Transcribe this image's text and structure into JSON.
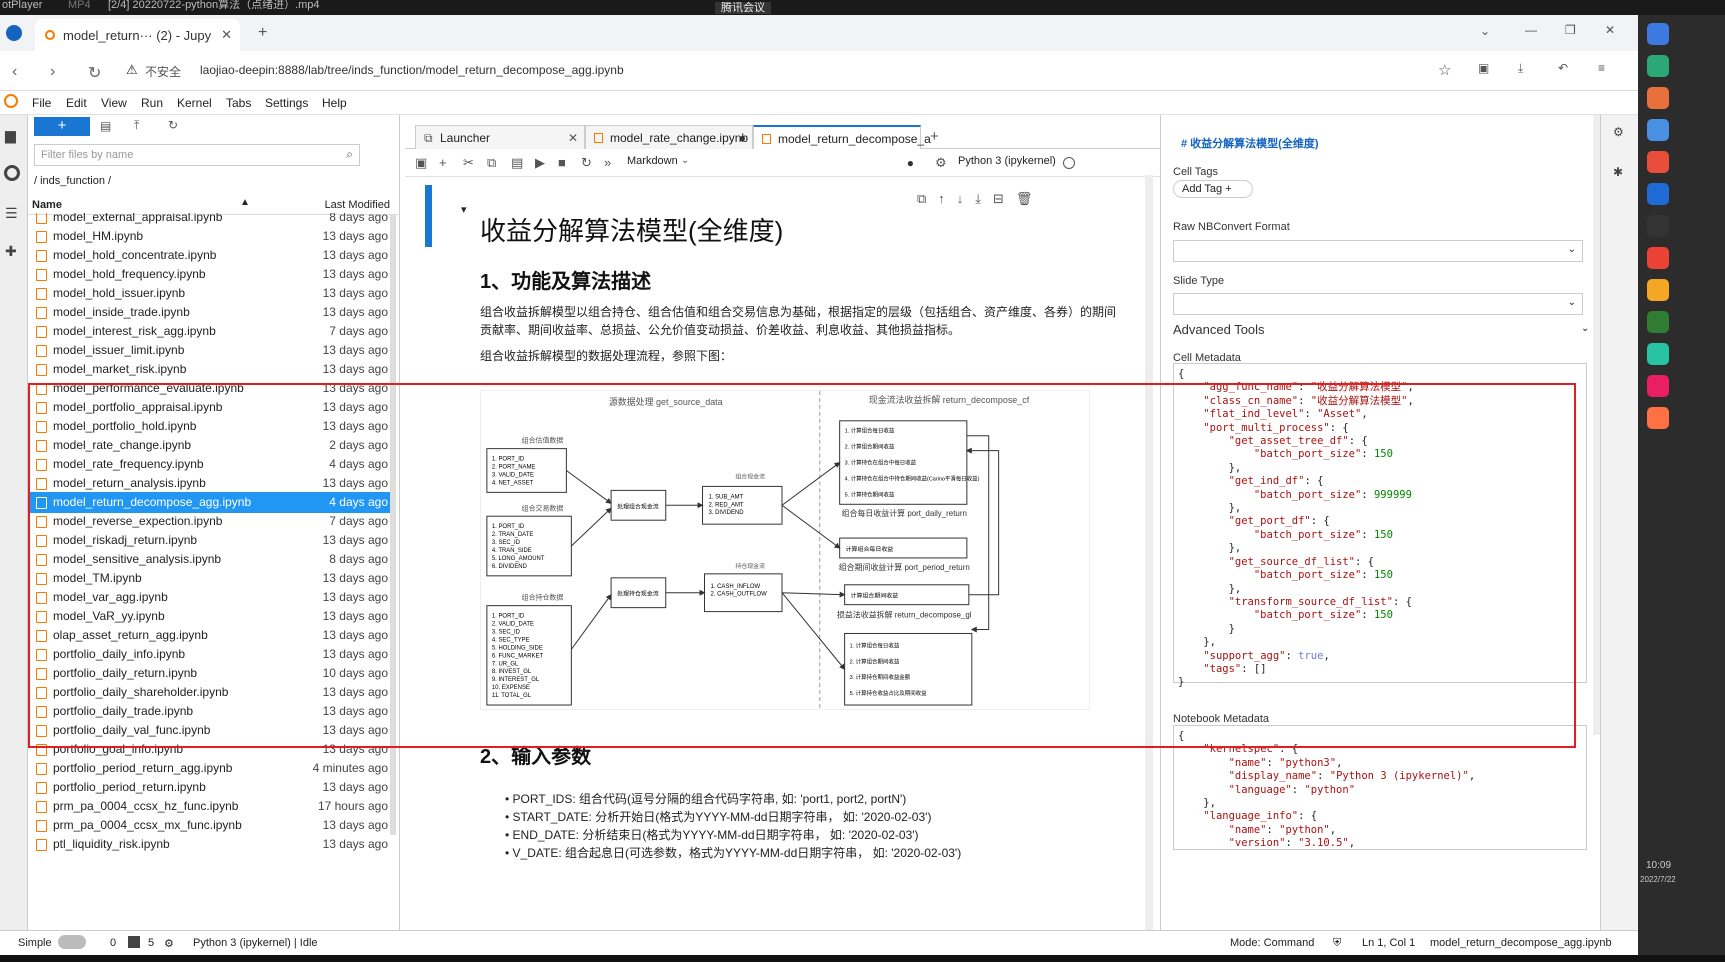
{
  "top_bar": {
    "player": "otPlayer",
    "format": "MP4",
    "video_title": "[2/4] 20220722-python算法（点绪进）.mp4",
    "meeting": "腾讯会议"
  },
  "browser": {
    "tab_title": "model_return··· (2) - Jupy",
    "security": "不安全",
    "url": "laojiao-deepin:8888/lab/tree/inds_function/model_return_decompose_agg.ipynb"
  },
  "menu": [
    "File",
    "Edit",
    "View",
    "Run",
    "Kernel",
    "Tabs",
    "Settings",
    "Help"
  ],
  "filebrowser": {
    "filter_placeholder": "Filter files by name",
    "path": "/ inds_function /",
    "col_name": "Name",
    "col_modified": "Last Modified",
    "files": [
      {
        "name": "model_external_appraisal.ipynb",
        "date": "8 days ago"
      },
      {
        "name": "model_HM.ipynb",
        "date": "13 days ago"
      },
      {
        "name": "model_hold_concentrate.ipynb",
        "date": "13 days ago"
      },
      {
        "name": "model_hold_frequency.ipynb",
        "date": "13 days ago"
      },
      {
        "name": "model_hold_issuer.ipynb",
        "date": "13 days ago"
      },
      {
        "name": "model_inside_trade.ipynb",
        "date": "13 days ago"
      },
      {
        "name": "model_interest_risk_agg.ipynb",
        "date": "7 days ago"
      },
      {
        "name": "model_issuer_limit.ipynb",
        "date": "13 days ago"
      },
      {
        "name": "model_market_risk.ipynb",
        "date": "13 days ago"
      },
      {
        "name": "model_performance_evaluate.ipynb",
        "date": "13 days ago"
      },
      {
        "name": "model_portfolio_appraisal.ipynb",
        "date": "13 days ago"
      },
      {
        "name": "model_portfolio_hold.ipynb",
        "date": "13 days ago"
      },
      {
        "name": "model_rate_change.ipynb",
        "date": "2 days ago"
      },
      {
        "name": "model_rate_frequency.ipynb",
        "date": "4 days ago"
      },
      {
        "name": "model_return_analysis.ipynb",
        "date": "13 days ago"
      },
      {
        "name": "model_return_decompose_agg.ipynb",
        "date": "4 days ago"
      },
      {
        "name": "model_reverse_expection.ipynb",
        "date": "7 days ago"
      },
      {
        "name": "model_riskadj_return.ipynb",
        "date": "13 days ago"
      },
      {
        "name": "model_sensitive_analysis.ipynb",
        "date": "8 days ago"
      },
      {
        "name": "model_TM.ipynb",
        "date": "13 days ago"
      },
      {
        "name": "model_var_agg.ipynb",
        "date": "13 days ago"
      },
      {
        "name": "model_VaR_yy.ipynb",
        "date": "13 days ago"
      },
      {
        "name": "olap_asset_return_agg.ipynb",
        "date": "13 days ago"
      },
      {
        "name": "portfolio_daily_info.ipynb",
        "date": "13 days ago"
      },
      {
        "name": "portfolio_daily_return.ipynb",
        "date": "10 days ago"
      },
      {
        "name": "portfolio_daily_shareholder.ipynb",
        "date": "13 days ago"
      },
      {
        "name": "portfolio_daily_trade.ipynb",
        "date": "13 days ago"
      },
      {
        "name": "portfolio_daily_val_func.ipynb",
        "date": "13 days ago"
      },
      {
        "name": "portfolio_goal_info.ipynb",
        "date": "13 days ago"
      },
      {
        "name": "portfolio_period_return_agg.ipynb",
        "date": "4 minutes ago"
      },
      {
        "name": "portfolio_period_return.ipynb",
        "date": "13 days ago"
      },
      {
        "name": "prm_pa_0004_ccsx_hz_func.ipynb",
        "date": "17 hours ago"
      },
      {
        "name": "prm_pa_0004_ccsx_mx_func.ipynb",
        "date": "13 days ago"
      },
      {
        "name": "ptl_liquidity_risk.ipynb",
        "date": "13 days ago"
      }
    ]
  },
  "nb_tabs": [
    {
      "label": "Launcher"
    },
    {
      "label": "model_rate_change.ipynb"
    },
    {
      "label": "model_return_decompose_a"
    }
  ],
  "toolbar": {
    "cell_type": "Markdown",
    "kernel": "Python 3 (ipykernel)"
  },
  "notebook": {
    "title": "收益分解算法模型(全维度)",
    "section1": "1、功能及算法描述",
    "para1": "组合收益拆解模型以组合持仓、组合估值和组合交易信息为基础，根据指定的层级（包括组合、资产维度、各券）的期间贡献率、期间收益率、总损益、公允价值变动损益、价差收益、利息收益、其他损益指标。",
    "para2": "组合收益拆解模型的数据处理流程，参照下图：",
    "diagram": {
      "get_source": "源数据处理\nget_source_data",
      "cashflow": "现金流法收益拆解\nreturn_decompose_cf",
      "port_daily": "组合每日收益计算\nport_daily_return",
      "port_period": "组合期间收益计算\nport_period_return",
      "gl": "损益法收益拆解\nreturn_decompose_gl",
      "valuation": "组合估值数据",
      "trade": "组合交易数据",
      "hold": "组合持仓数据",
      "proc_cash": "处理组合现金流",
      "proc_hold": "处理持仓现金流",
      "val_items": [
        "1. PORT_ID",
        "2. PORT_NAME",
        "3. VALID_DATE",
        "4. NET_ASSET"
      ],
      "trade_items": [
        "1. PORT_ID",
        "2. TRAN_DATE",
        "3. SEC_ID",
        "4. TRAN_SIDE",
        "5. LONG_AMOUNT",
        "6. DIVIDEND"
      ],
      "hold_items": [
        "1. PORT_ID",
        "2. VALID_DATE",
        "3. SEC_ID",
        "4. SEC_TYPE",
        "5. HOLDING_SIDE",
        "6. FUNC_MARKET",
        "7. UR_GL",
        "8. INVEST_GL",
        "9. INTEREST_GL",
        "10. EXPENSE",
        "11. TOTAL_GL"
      ],
      "portcash_label": "组合现金流",
      "portcash_items": [
        "1. SUB_AMT",
        "2. RED_AMT",
        "3. DIVIDEND"
      ],
      "holdcash_label": "持仓现金流",
      "holdcash_items": [
        "1. CASH_INFLOW",
        "2. CASH_OUTFLOW"
      ],
      "cf_items": [
        "1. 计算组合每日收益",
        "2. 计算组合期间收益",
        "3. 计算持仓在组合中每日收益",
        "4. 计算持仓在组合中持仓期间收益(Carino平滑每日收益)",
        "5. 计算持仓期间收益"
      ],
      "daily_item": "计算组合每日收益",
      "period_item": "计算组合期间收益",
      "gl_items": [
        "1. 计算组合每日收益",
        "2. 计算组合期间收益",
        "3. 计算持仓期间收益金额",
        "5. 计算持仓收益占比及期间收益"
      ]
    },
    "section2": "2、输入参数",
    "bullets": [
      "PORT_IDS: 组合代码(逗号分隔的组合代码字符串, 如: 'port1, port2, portN')",
      "START_DATE: 分析开始日(格式为YYYY-MM-dd日期字符串， 如: '2020-02-03')",
      "END_DATE: 分析结束日(格式为YYYY-MM-dd日期字符串， 如: '2020-02-03')",
      "V_DATE: 组合起息日(可选参数，格式为YYYY-MM-dd日期字符串， 如: '2020-02-03')"
    ]
  },
  "rightpanel": {
    "header": "# 收益分解算法模型(全维度)",
    "cell_tags": "Cell Tags",
    "add_tag": "Add Tag",
    "raw_format": "Raw NBConvert Format",
    "slide_type": "Slide Type",
    "advanced": "Advanced Tools",
    "cell_metadata": "Cell Metadata",
    "notebook_metadata": "Notebook Metadata"
  },
  "statusbar": {
    "mode_simple": "Simple",
    "count0": "0",
    "count5": "5",
    "kernel_status": "Python 3 (ipykernel) | Idle",
    "mode": "Mode: Command",
    "position": "Ln 1, Col 1",
    "filename": "model_return_decompose_agg.ipynb"
  },
  "dock": {
    "time": "10:09",
    "date": "2022/7/22"
  },
  "colors": {
    "accent": "#1976d2",
    "selection": "#2196f3",
    "annotation": "#e02020",
    "orange": "#f57c00"
  }
}
